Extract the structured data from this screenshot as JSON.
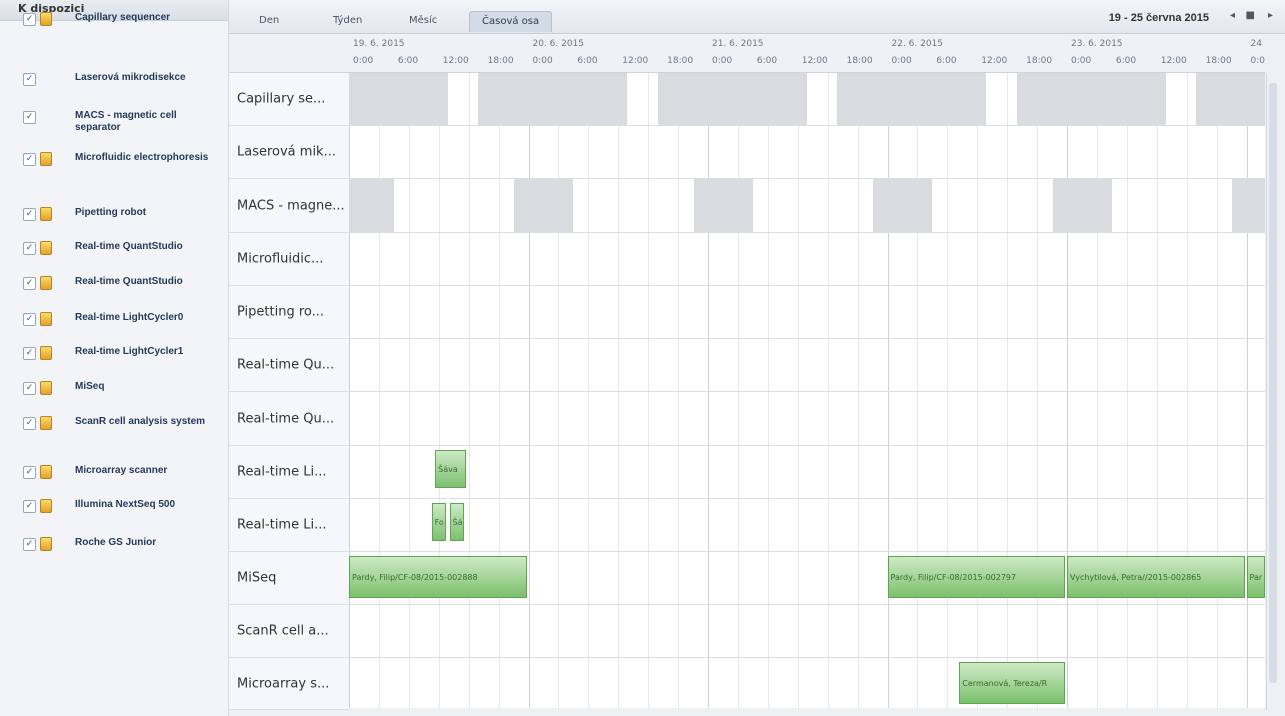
{
  "left_panel": {
    "header": "K dispozici",
    "resources": [
      {
        "name": "Capillary sequencer",
        "checked": true,
        "icon": true
      },
      {
        "name": "Laserová mikrodisekce",
        "checked": true,
        "icon": false
      },
      {
        "name": "MACS - magnetic cell separator",
        "checked": true,
        "icon": false
      },
      {
        "name": "Microfluidic electrophoresis",
        "checked": true,
        "icon": true
      },
      {
        "name": "Pipetting robot",
        "checked": true,
        "icon": true
      },
      {
        "name": "Real-time QuantStudio",
        "checked": true,
        "icon": true
      },
      {
        "name": "Real-time QuantStudio",
        "checked": true,
        "icon": true
      },
      {
        "name": "Real-time LightCycler0",
        "checked": true,
        "icon": true
      },
      {
        "name": "Real-time LightCycler1",
        "checked": true,
        "icon": true
      },
      {
        "name": "MiSeq",
        "checked": true,
        "icon": true
      },
      {
        "name": "ScanR cell analysis system",
        "checked": true,
        "icon": true
      },
      {
        "name": "Microarray scanner",
        "checked": true,
        "icon": true
      },
      {
        "name": "Illumina NextSeq 500",
        "checked": true,
        "icon": true
      },
      {
        "name": "Roche GS Junior",
        "checked": true,
        "icon": true
      }
    ]
  },
  "tabs": [
    "Den",
    "Týden",
    "Měsíc",
    "Časová osa"
  ],
  "active_tab": "Časová osa",
  "date_range": "19 - 25 června 2015",
  "nav": {
    "prev": "◂",
    "today": "■",
    "next": "▸"
  },
  "days": [
    "19. 6. 2015",
    "20. 6. 2015",
    "21. 6. 2015",
    "22. 6. 2015",
    "23. 6. 2015",
    "24"
  ],
  "hours": [
    "0:00",
    "6:00",
    "12:00",
    "18:00"
  ],
  "rows": [
    "Capillary se...",
    "Laserová mik...",
    "MACS - magne...",
    "Microfluidic...",
    "Pipetting ro...",
    "Real-time Qu...",
    "Real-time Qu...",
    "Real-time Li...",
    "Real-time Li...",
    "MiSeq",
    "ScanR cell a...",
    "Microarray s..."
  ],
  "unavailable_blocks": [
    {
      "row": 0,
      "start": 0,
      "end": 0.55
    },
    {
      "row": 0,
      "start": 0.72,
      "end": 1.55
    },
    {
      "row": 0,
      "start": 1.72,
      "end": 2.55
    },
    {
      "row": 0,
      "start": 2.72,
      "end": 3.55
    },
    {
      "row": 0,
      "start": 3.72,
      "end": 4.55
    },
    {
      "row": 0,
      "start": 4.72,
      "end": 5.3
    },
    {
      "row": 2,
      "start": 0,
      "end": 0.25
    },
    {
      "row": 2,
      "start": 0.92,
      "end": 1.25
    },
    {
      "row": 2,
      "start": 1.92,
      "end": 2.25
    },
    {
      "row": 2,
      "start": 2.92,
      "end": 3.25
    },
    {
      "row": 2,
      "start": 3.92,
      "end": 4.25
    },
    {
      "row": 2,
      "start": 4.92,
      "end": 5.3
    }
  ],
  "events": [
    {
      "row": 7,
      "start": 0.48,
      "end": 0.65,
      "label": "Šáva"
    },
    {
      "row": 8,
      "start": 0.46,
      "end": 0.54,
      "label": "Fo"
    },
    {
      "row": 8,
      "start": 0.56,
      "end": 0.64,
      "label": "Šá"
    },
    {
      "row": 9,
      "start": 0.0,
      "end": 0.99,
      "label": "Pardy, Filip/CF-08/2015-002888"
    },
    {
      "row": 9,
      "start": 3.0,
      "end": 3.99,
      "label": "Pardy, Filip/CF-08/2015-002797"
    },
    {
      "row": 9,
      "start": 4.0,
      "end": 4.99,
      "label": "Vychytilová, Petra//2015-002865"
    },
    {
      "row": 9,
      "start": 5.0,
      "end": 5.3,
      "label": "Par"
    },
    {
      "row": 11,
      "start": 3.4,
      "end": 3.99,
      "label": "Cermanová, Tereza/R"
    }
  ]
}
